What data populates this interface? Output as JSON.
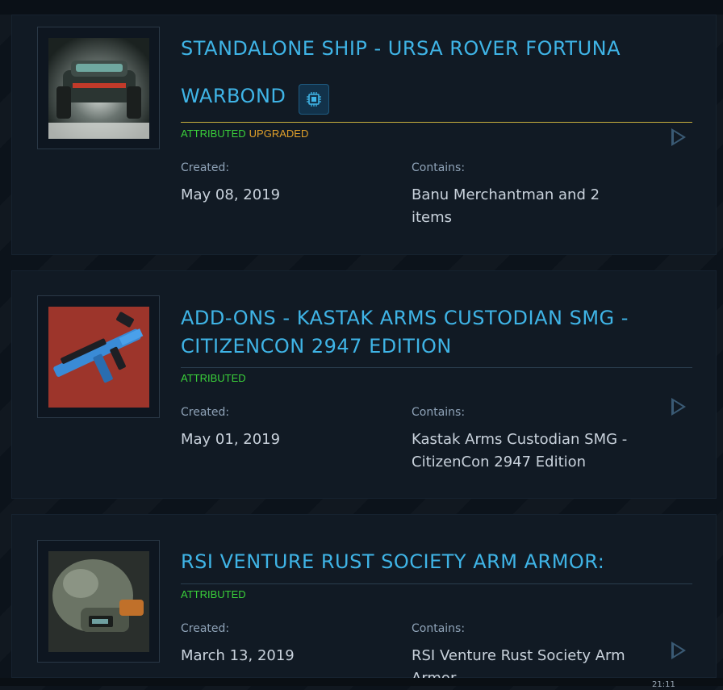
{
  "items": [
    {
      "title_line1": "STANDALONE SHIP - URSA ROVER FORTUNA",
      "title_line2": "WARBOND",
      "tags": [
        "ATTRIBUTED",
        "UPGRADED"
      ],
      "created_label": "Created:",
      "created": "May 08, 2019",
      "contains_label": "Contains:",
      "contains": "Banu Merchantman and 2 items",
      "icon": "rover-image",
      "badge_icon": "chip-icon"
    },
    {
      "title": "ADD-ONS - KASTAK ARMS CUSTODIAN SMG - CITIZENCON 2947 EDITION",
      "tags": [
        "ATTRIBUTED"
      ],
      "created_label": "Created:",
      "created": "May 01, 2019",
      "contains_label": "Contains:",
      "contains": "Kastak Arms Custodian SMG - CitizenCon 2947 Edition",
      "icon": "smg-image"
    },
    {
      "title": "RSI VENTURE RUST SOCIETY ARM ARMOR:",
      "tags": [
        "ATTRIBUTED"
      ],
      "created_label": "Created:",
      "created": "March 13, 2019",
      "contains_label": "Contains:",
      "contains": "RSI Venture Rust Society Arm Armor",
      "icon": "armor-image"
    }
  ],
  "footer": {
    "time": "21:11"
  },
  "colors": {
    "title": "#3fb4e6",
    "attributed": "#3ad03a",
    "upgraded": "#e0a02a",
    "gold_line": "#c9b03e"
  }
}
